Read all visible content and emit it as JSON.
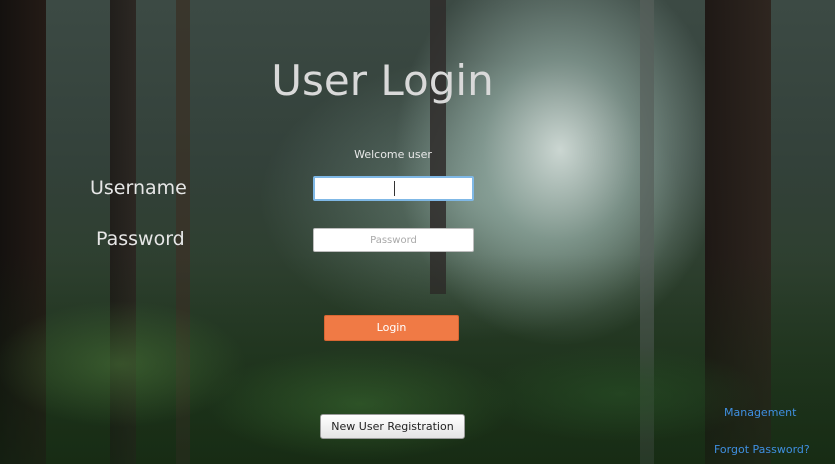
{
  "page": {
    "title": "User Login",
    "welcome": "Welcome user"
  },
  "form": {
    "username_label": "Username",
    "username_value": "",
    "password_label": "Password",
    "password_placeholder": "Password",
    "password_value": "",
    "login_label": "Login"
  },
  "footer": {
    "register_label": "New User Registration",
    "management_link": "Management",
    "forgot_link": "Forgot Password?"
  },
  "colors": {
    "login_button": "#f07a45",
    "link": "#3f8fe0",
    "focus_border": "#7fb8e6"
  }
}
